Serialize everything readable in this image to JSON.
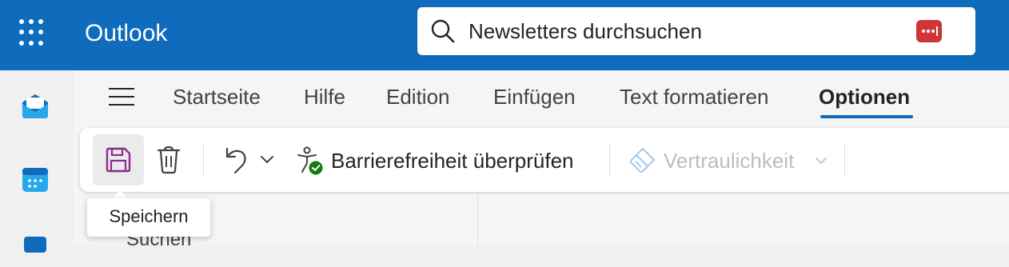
{
  "app": {
    "title": "Outlook"
  },
  "search": {
    "placeholder": "Newsletters durchsuchen"
  },
  "tabs": [
    {
      "label": "Startseite"
    },
    {
      "label": "Hilfe"
    },
    {
      "label": "Edition"
    },
    {
      "label": "Einfügen"
    },
    {
      "label": "Text formatieren"
    },
    {
      "label": "Optionen",
      "active": true
    }
  ],
  "ribbon": {
    "accessibility_label": "Barrierefreiheit überprüfen",
    "confidentiality_label": "Vertraulichkeit"
  },
  "tooltip": {
    "text": "Speichern"
  },
  "partial": {
    "text": "Suchen"
  },
  "colors": {
    "brand": "#0f6cbd",
    "save_icon": "#8b2c8f",
    "check": "#107c10",
    "badge": "#d13438"
  }
}
